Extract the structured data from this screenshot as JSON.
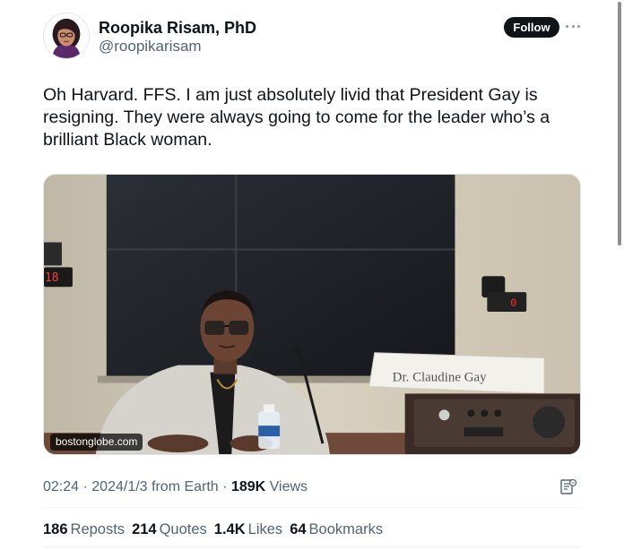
{
  "author": {
    "name": "Roopika Risam, PhD",
    "handle": "@roopikarisam",
    "follow_label": "Follow"
  },
  "tweet": {
    "text_lines": [
      "Oh Harvard. FFS. I am just absolutely livid that President Gay is",
      "resigning. They were always going to come for the leader who’s a",
      "brilliant Black woman."
    ]
  },
  "media": {
    "source_label": "bostonglobe.com",
    "nameplate_text": "Dr. Claudine Gay",
    "clock_left": "18",
    "clock_right": "0"
  },
  "meta": {
    "time": "02:24",
    "date": "2024/1/3",
    "from": "from Earth",
    "views_count": "189K",
    "views_label": "Views",
    "separator": "·"
  },
  "stats": {
    "reposts_count": "186",
    "reposts_label": "Reposts",
    "quotes_count": "214",
    "quotes_label": "Quotes",
    "likes_count": "1.4K",
    "likes_label": "Likes",
    "bookmarks_count": "64",
    "bookmarks_label": "Bookmarks"
  },
  "colors": {
    "text_primary": "#0f1419",
    "text_secondary": "#536471",
    "follow_bg": "#0f1419",
    "divider": "#eff3f4"
  },
  "icons": {
    "more": "more-icon",
    "analytics": "analytics-icon"
  }
}
